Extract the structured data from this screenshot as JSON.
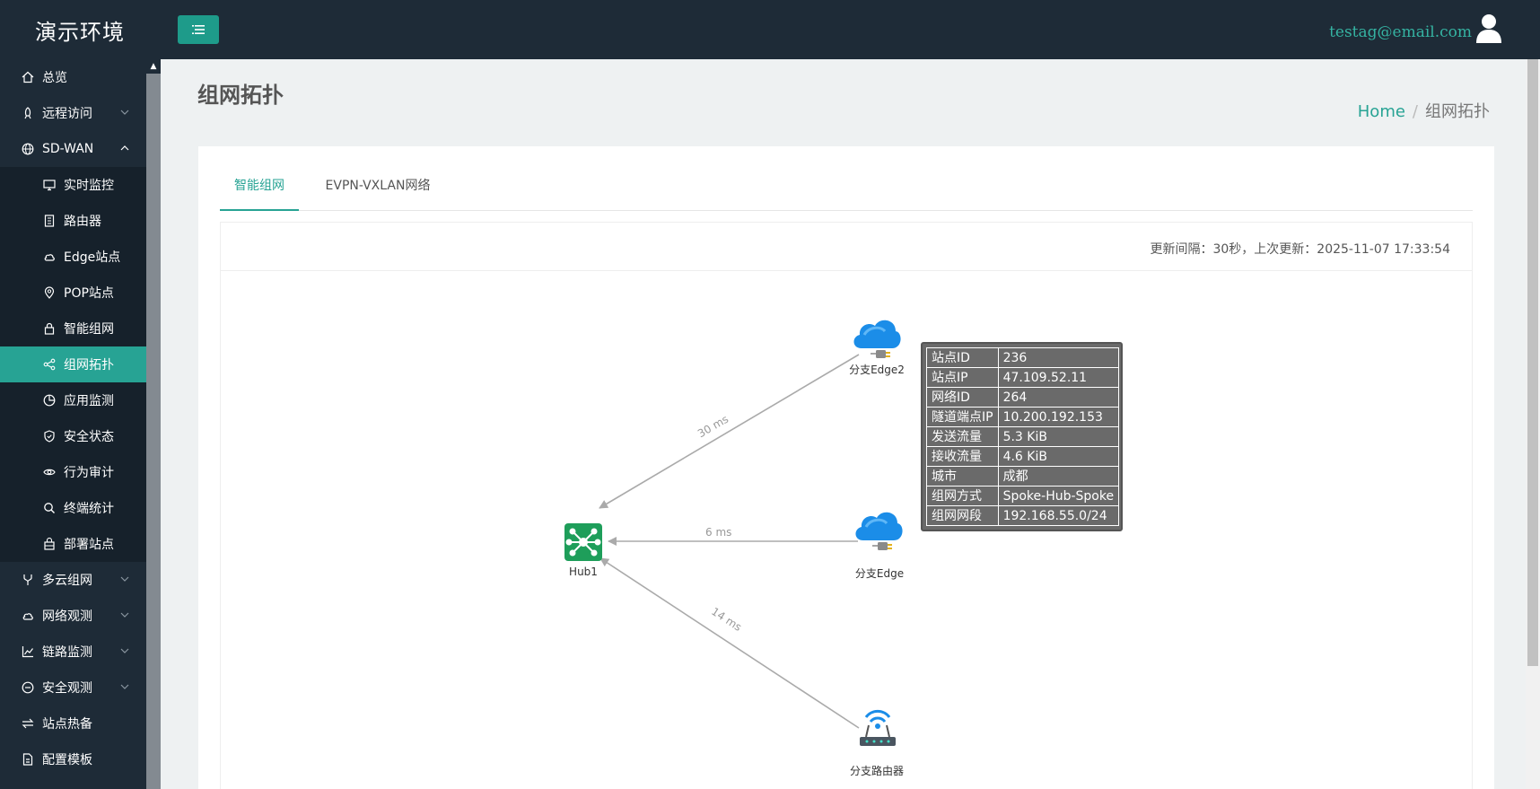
{
  "app": {
    "brand": "演示环境",
    "user_email": "testag@email.com"
  },
  "sidebar": {
    "items": [
      {
        "label": "总览",
        "icon": "home-icon"
      },
      {
        "label": "远程访问",
        "icon": "rocket-icon"
      },
      {
        "label": "SD-WAN",
        "icon": "globe-icon"
      },
      {
        "label": "实时监控",
        "icon": "monitor-icon"
      },
      {
        "label": "路由器",
        "icon": "router-icon"
      },
      {
        "label": "Edge站点",
        "icon": "cloud-icon"
      },
      {
        "label": "POP站点",
        "icon": "location-pin-icon"
      },
      {
        "label": "智能组网",
        "icon": "lock-icon"
      },
      {
        "label": "组网拓扑",
        "icon": "share-icon"
      },
      {
        "label": "应用监测",
        "icon": "pie-chart-icon"
      },
      {
        "label": "安全状态",
        "icon": "shield-check-icon"
      },
      {
        "label": "行为审计",
        "icon": "eye-icon"
      },
      {
        "label": "终端统计",
        "icon": "search-icon"
      },
      {
        "label": "部署站点",
        "icon": "inbox-icon"
      },
      {
        "label": "多云组网",
        "icon": "fork-icon"
      },
      {
        "label": "网络观测",
        "icon": "cloud-icon"
      },
      {
        "label": "链路监测",
        "icon": "line-chart-icon"
      },
      {
        "label": "安全观测",
        "icon": "minus-circle-icon"
      },
      {
        "label": "站点热备",
        "icon": "swap-icon"
      },
      {
        "label": "配置模板",
        "icon": "file-icon"
      }
    ]
  },
  "page": {
    "title": "组网拓扑",
    "breadcrumb": {
      "home": "Home",
      "current": "组网拓扑"
    }
  },
  "tabs": [
    {
      "label": "智能组网",
      "active": true
    },
    {
      "label": "EVPN-VXLAN网络",
      "active": false
    }
  ],
  "panel": {
    "refresh_info": "更新间隔：30秒，上次更新：2025-11-07 17:33:54"
  },
  "topology": {
    "nodes": {
      "hub": "Hub1",
      "edge2": "分支Edge2",
      "edge": "分支Edge",
      "router": "分支路由器"
    },
    "links": {
      "edge2": "30 ms",
      "edge": "6 ms",
      "router": "14 ms"
    }
  },
  "tooltip": {
    "rows": [
      {
        "k": "站点ID",
        "v": "236"
      },
      {
        "k": "站点IP",
        "v": "47.109.52.11"
      },
      {
        "k": "网络ID",
        "v": "264"
      },
      {
        "k": "隧道端点IP",
        "v": "10.200.192.153"
      },
      {
        "k": "发送流量",
        "v": "5.3 KiB"
      },
      {
        "k": "接收流量",
        "v": "4.6 KiB"
      },
      {
        "k": "城市",
        "v": "成都"
      },
      {
        "k": "组网方式",
        "v": "Spoke-Hub-Spoke"
      },
      {
        "k": "组网网段",
        "v": "192.168.55.0/24"
      }
    ]
  },
  "colors": {
    "accent": "#27a394",
    "sidebar_bg": "#1e2b37",
    "hub_green": "#1e9e5a"
  }
}
